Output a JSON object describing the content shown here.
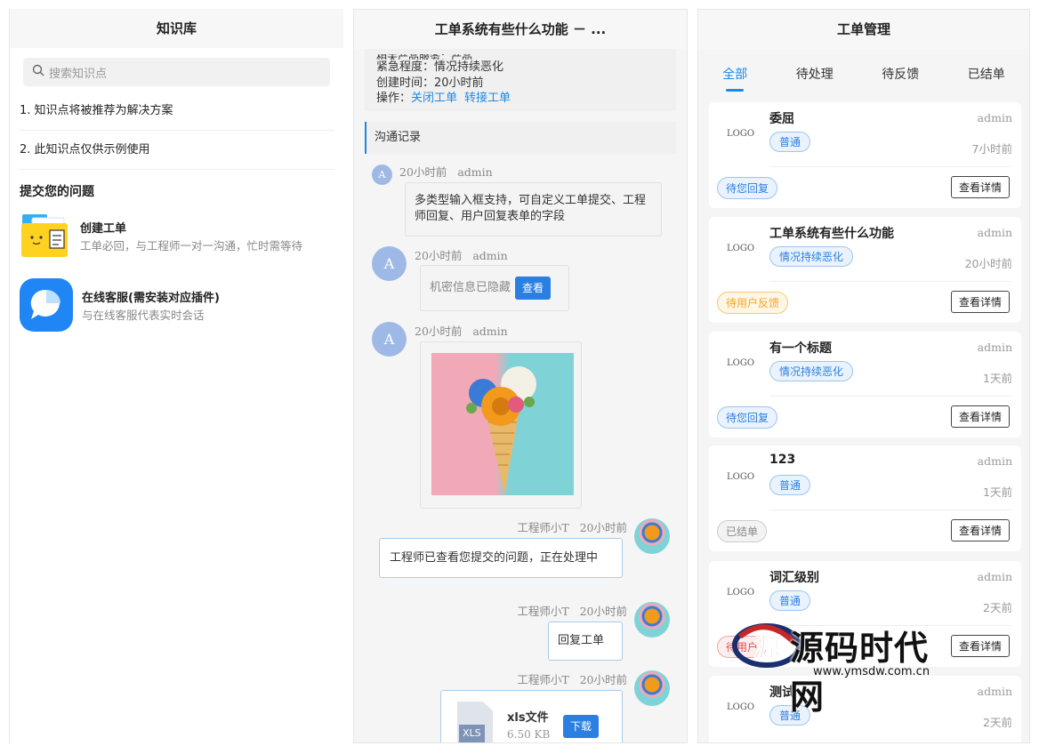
{
  "knowledge": {
    "title": "知识库",
    "search_placeholder": "搜索知识点",
    "items": [
      "1. 知识点将被推荐为解决方案",
      "2. 此知识点仅供示例使用"
    ],
    "section_title": "提交您的问题",
    "services": [
      {
        "title": "创建工单",
        "desc": "工单必回，与工程师一对一沟通，忙时需等待",
        "icon": "folder-ticket-icon"
      },
      {
        "title": "在线客服(需安装对应插件)",
        "desc": "与在线客服代表实时会话",
        "icon": "chat-bubble-icon"
      }
    ]
  },
  "ticket": {
    "title": "工单系统有些什么功能 － ...",
    "cut_line": "相关产品服务：产品",
    "urgency": "紧急程度：情况持续恶化",
    "created": "创建时间：20小时前",
    "ops_label": "操作：",
    "op_close": "关闭工单",
    "op_transfer": "转接工单",
    "comm_title": "沟通记录",
    "messages": [
      {
        "avatar": "A",
        "time": "20小时前",
        "user": "admin",
        "text": "多类型输入框支持，可自定义工单提交、工程师回复、用户回复表单的字段"
      },
      {
        "avatar": "A",
        "time": "20小时前",
        "user": "admin",
        "text": "机密信息已隐藏",
        "button": "查看"
      },
      {
        "avatar": "A",
        "time": "20小时前",
        "user": "admin",
        "image": "flower-cone-image"
      },
      {
        "user": "工程师小T",
        "time": "20小时前",
        "text": "工程师已查看您提交的问题，正在处理中"
      },
      {
        "user": "工程师小T",
        "time": "20小时前",
        "text": "回复工单"
      },
      {
        "user": "工程师小T",
        "time": "20小时前",
        "file_badge": "XLS",
        "file_name": "xls文件",
        "file_size": "6.50 KB",
        "button": "下载"
      }
    ]
  },
  "manage": {
    "title": "工单管理",
    "tabs": [
      "全部",
      "待处理",
      "待反馈",
      "已结单"
    ],
    "active_tab": 0,
    "logo_text": "LOGO",
    "detail_label": "查看详情",
    "cards": [
      {
        "title": "委屈",
        "user": "admin",
        "tag": "普通",
        "time": "7小时前",
        "status": "待您回复",
        "status_color": "blue"
      },
      {
        "title": "工单系统有些什么功能",
        "user": "admin",
        "tag": "情况持续恶化",
        "time": "20小时前",
        "status": "待用户反馈",
        "status_color": "orange"
      },
      {
        "title": "有一个标题",
        "user": "admin",
        "tag": "情况持续恶化",
        "time": "1天前",
        "status": "待您回复",
        "status_color": "blue"
      },
      {
        "title": "123",
        "user": "admin",
        "tag": "普通",
        "time": "1天前",
        "status": "已结单",
        "status_color": "gray"
      },
      {
        "title": "词汇级别",
        "user": "admin",
        "tag": "普通",
        "time": "2天前",
        "status": "待用户",
        "status_color": "red"
      },
      {
        "title": "测试",
        "user": "admin",
        "tag": "普通",
        "time": "2天前",
        "status": "",
        "status_color": ""
      }
    ]
  },
  "watermark": {
    "name": "源码时代网",
    "url": "www.ymsdw.com.cn"
  },
  "colors": {
    "accent": "#1e88e5",
    "orange": "#f5a623",
    "panel_bg": "#f5f5f5"
  }
}
